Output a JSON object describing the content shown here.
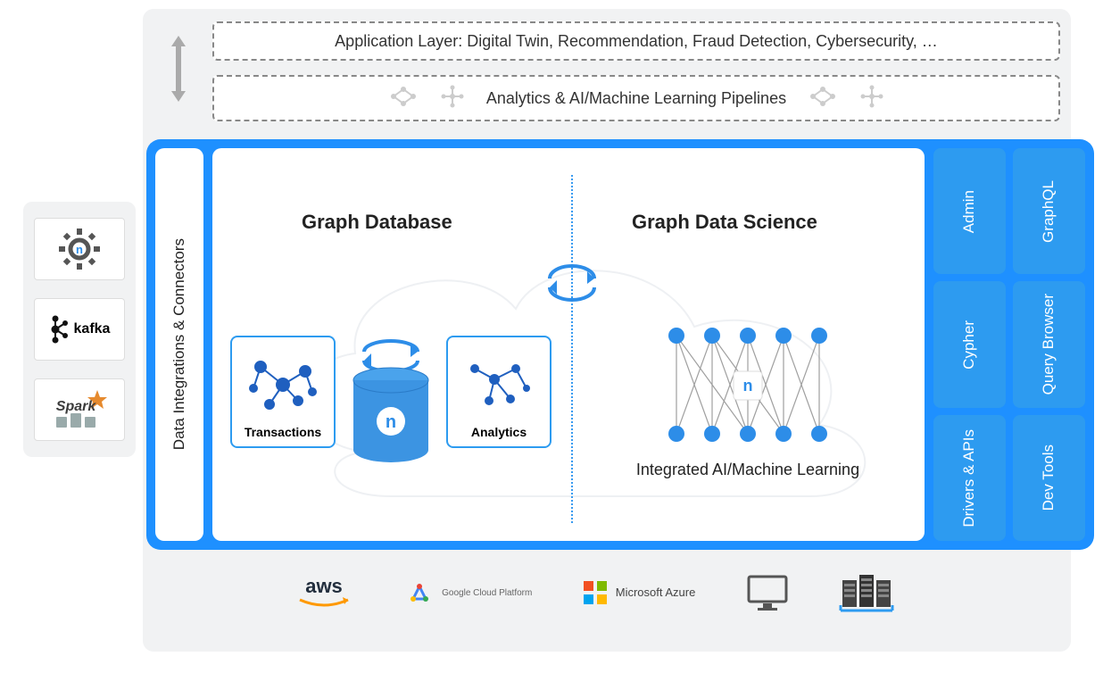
{
  "layers": {
    "application": "Application Layer: Digital Twin, Recommendation, Fraud Detection, Cybersecurity, …",
    "analytics": "Analytics & AI/Machine Learning Pipelines"
  },
  "leftIntegrations": {
    "gear": "",
    "kafka": "kafka",
    "spark": "Spark"
  },
  "main": {
    "leftStrip": "Data Integrations & Connectors",
    "graphDatabase": "Graph Database",
    "graphDataScience": "Graph Data Science",
    "cards": {
      "transactions": "Transactions",
      "analytics": "Analytics"
    },
    "integratedML": "Integrated AI/Machine Learning"
  },
  "rightTiles": {
    "admin": "Admin",
    "graphql": "GraphQL",
    "cypher": "Cypher",
    "queryBrowser": "Query Browser",
    "driversApis": "Drivers & APIs",
    "devTools": "Dev Tools"
  },
  "providers": {
    "aws": "aws",
    "gcp": "Google Cloud Platform",
    "azure": "Microsoft Azure"
  }
}
